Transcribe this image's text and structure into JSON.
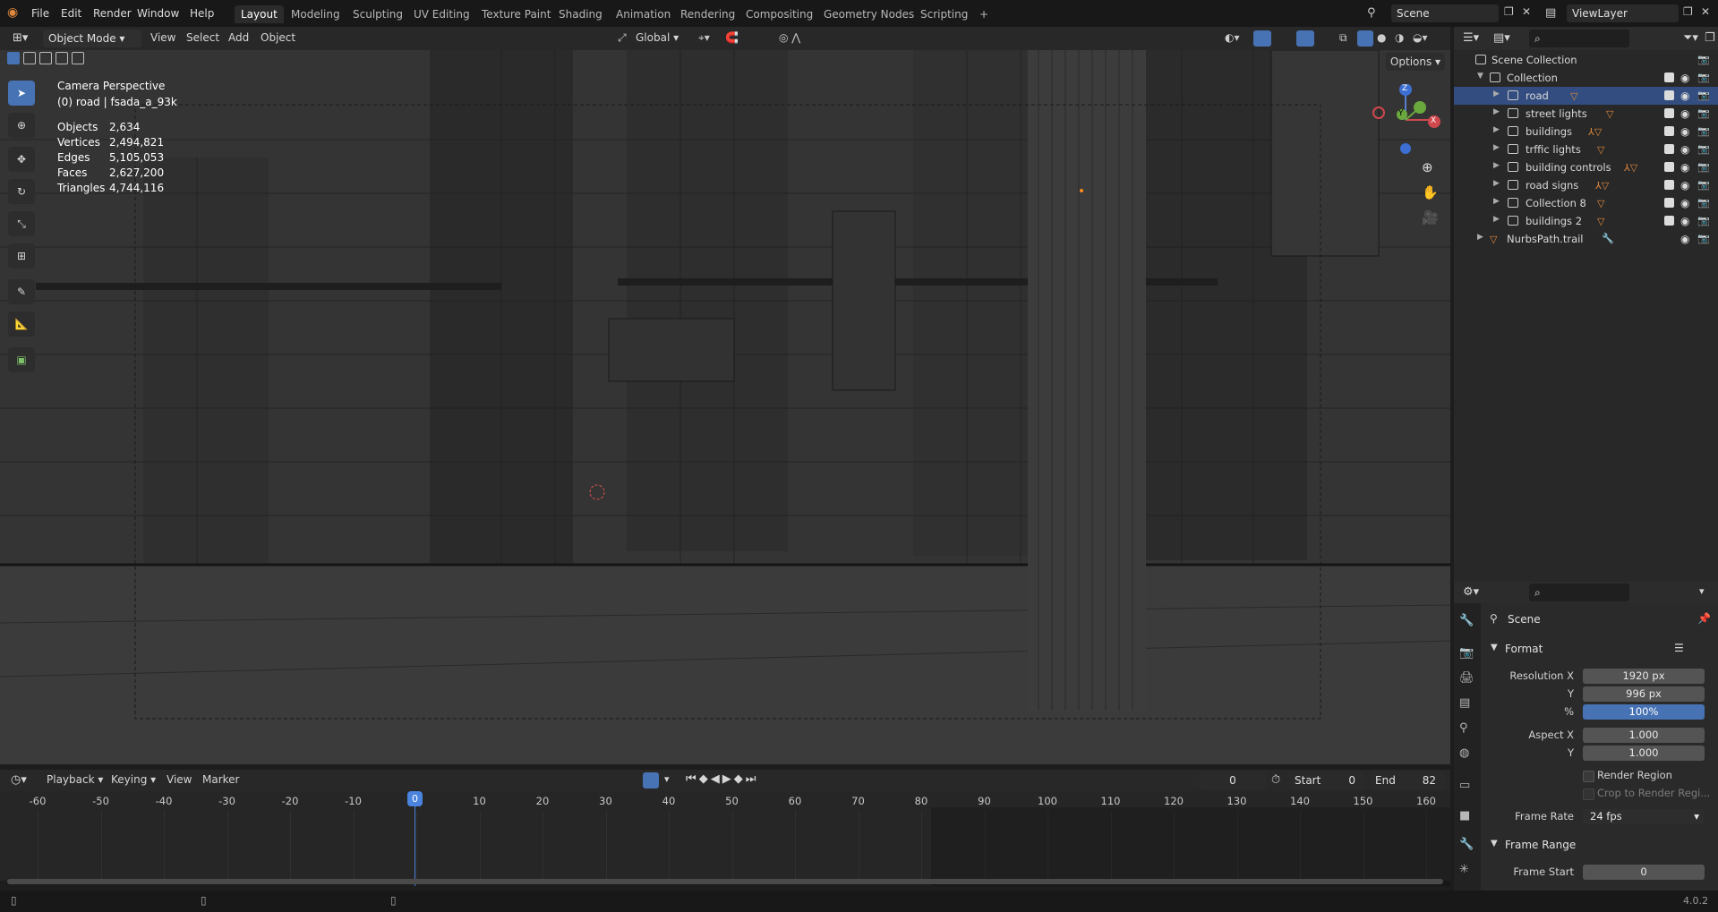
{
  "menu": {
    "items": [
      "File",
      "Edit",
      "Render",
      "Window",
      "Help"
    ]
  },
  "workspaces": {
    "tabs": [
      "Layout",
      "Modeling",
      "Sculpting",
      "UV Editing",
      "Texture Paint",
      "Shading",
      "Animation",
      "Rendering",
      "Compositing",
      "Geometry Nodes",
      "Scripting"
    ],
    "active": "Layout",
    "add_label": "+"
  },
  "scene": {
    "name": "Scene"
  },
  "view_layer": {
    "name": "ViewLayer"
  },
  "viewport_header": {
    "mode": "Object Mode",
    "menus": [
      "View",
      "Select",
      "Add",
      "Object"
    ],
    "transform_orientation": "Global",
    "options_label": "Options"
  },
  "viewport": {
    "camera_label": "Camera Perspective",
    "active_object": "(0) road | fsada_a_93k",
    "stats": [
      {
        "label": "Objects",
        "value": "2,634"
      },
      {
        "label": "Vertices",
        "value": "2,494,821"
      },
      {
        "label": "Edges",
        "value": "5,105,053"
      },
      {
        "label": "Faces",
        "value": "2,627,200"
      },
      {
        "label": "Triangles",
        "value": "4,744,116"
      }
    ],
    "gizmo_axes": {
      "z": "Z",
      "y": "Y",
      "x": "X"
    }
  },
  "outliner": {
    "root": "Scene Collection",
    "collection": "Collection",
    "items": [
      {
        "name": "road",
        "selected": true,
        "badge": "9"
      },
      {
        "name": "street lights",
        "badge": "41"
      },
      {
        "name": "buildings",
        "badge": "2K"
      },
      {
        "name": "trffic lights",
        "badge": "6"
      },
      {
        "name": "building controls",
        "badge": "94"
      },
      {
        "name": "road signs",
        "badge": "6"
      },
      {
        "name": "Collection 8",
        "badge": "6"
      },
      {
        "name": "buildings 2",
        "badge": "2"
      }
    ],
    "extra_item": "NurbsPath.trail"
  },
  "properties": {
    "context": "Scene",
    "format_section": "Format",
    "resolution_x_label": "Resolution X",
    "resolution_x": "1920 px",
    "resolution_y_label": "Y",
    "resolution_y": "996 px",
    "percent_label": "%",
    "percent": "100%",
    "aspect_x_label": "Aspect X",
    "aspect_x": "1.000",
    "aspect_y_label": "Y",
    "aspect_y": "1.000",
    "render_region": "Render Region",
    "crop_region": "Crop to Render Regi...",
    "frame_rate_label": "Frame Rate",
    "frame_rate": "24 fps",
    "frame_range_section": "Frame Range",
    "frame_start_label": "Frame Start",
    "frame_start": "0"
  },
  "timeline": {
    "menus": [
      "Playback",
      "Keying",
      "View",
      "Marker"
    ],
    "current_frame": "0",
    "start_label": "Start",
    "start": "0",
    "end_label": "End",
    "end": "82",
    "ticks": [
      "-60",
      "-50",
      "-40",
      "-30",
      "-20",
      "-10",
      "0",
      "10",
      "20",
      "30",
      "40",
      "50",
      "60",
      "70",
      "80",
      "90",
      "100",
      "110",
      "120",
      "130",
      "140",
      "150",
      "160"
    ],
    "playhead": "0"
  },
  "status": {
    "version": "4.0.2"
  }
}
